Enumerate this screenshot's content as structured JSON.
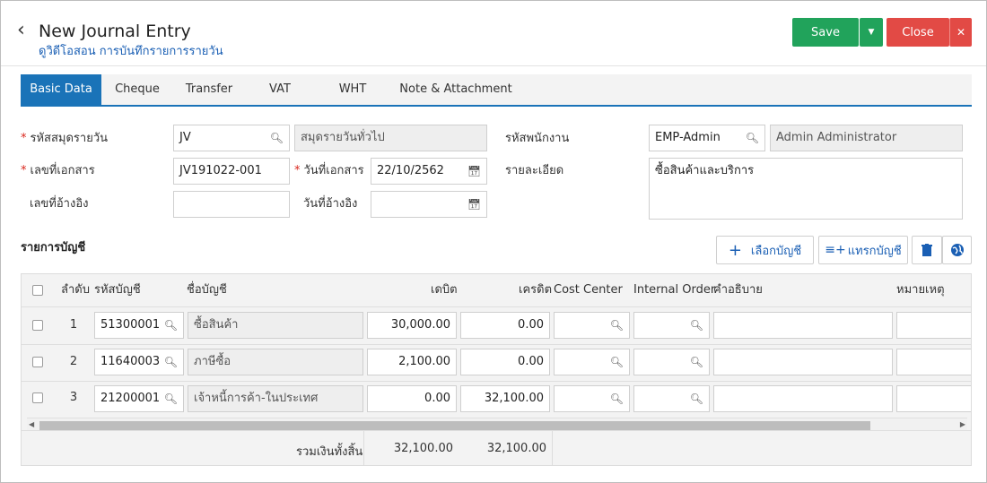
{
  "header": {
    "title": "New Journal Entry",
    "subtitle": "ดูวิดีโอสอน การบันทึกรายการรายวัน",
    "save_label": "Save",
    "close_label": "Close"
  },
  "tabs": [
    {
      "label": "Basic Data"
    },
    {
      "label": "Cheque"
    },
    {
      "label": "Transfer"
    },
    {
      "label": "VAT"
    },
    {
      "label": "WHT"
    },
    {
      "label": "Note & Attachment"
    }
  ],
  "form": {
    "journal_code_label": "รหัสสมุดรายวัน",
    "journal_code_value": "JV",
    "journal_name_value": "สมุดรายวันทั่วไป",
    "doc_no_label": "เลขที่เอกสาร",
    "doc_no_value": "JV191022-001",
    "doc_date_label": "วันที่เอกสาร",
    "doc_date_value": "22/10/2562",
    "ref_no_label": "เลขที่อ้างอิง",
    "ref_no_value": "",
    "ref_date_label": "วันที่อ้างอิง",
    "ref_date_value": "",
    "employee_code_label": "รหัสพนักงาน",
    "employee_code_value": "EMP-Admin",
    "employee_name_value": "Admin Administrator",
    "description_label": "รายละเอียด",
    "description_value": "ซื้อสินค้าและบริการ"
  },
  "accounts": {
    "section_title": "รายการบัญชี",
    "select_account_label": "เลือกบัญชี",
    "insert_account_label": "แทรกบัญชี",
    "columns": {
      "seq": "ลำดับ",
      "account_code": "รหัสบัญชี",
      "account_name": "ชื่อบัญชี",
      "debit": "เดบิต",
      "credit": "เครดิต",
      "cost_center": "Cost Center",
      "internal_order": "Internal Order",
      "description": "คำอธิบาย",
      "remark": "หมายเหตุ"
    },
    "rows": [
      {
        "seq": "1",
        "code": "51300001",
        "name": "ซื้อสินค้า",
        "debit": "30,000.00",
        "credit": "0.00"
      },
      {
        "seq": "2",
        "code": "11640003",
        "name": "ภาษีซื้อ",
        "debit": "2,100.00",
        "credit": "0.00"
      },
      {
        "seq": "3",
        "code": "21200001",
        "name": "เจ้าหนี้การค้า-ในประเทศ",
        "debit": "0.00",
        "credit": "32,100.00"
      }
    ],
    "total_label": "รวมเงินทั้งสิ้น",
    "total_debit": "32,100.00",
    "total_credit": "32,100.00"
  },
  "colors": {
    "primary": "#1a73b8",
    "save": "#21a35b",
    "close": "#e24a45",
    "required": "#d9261c"
  }
}
